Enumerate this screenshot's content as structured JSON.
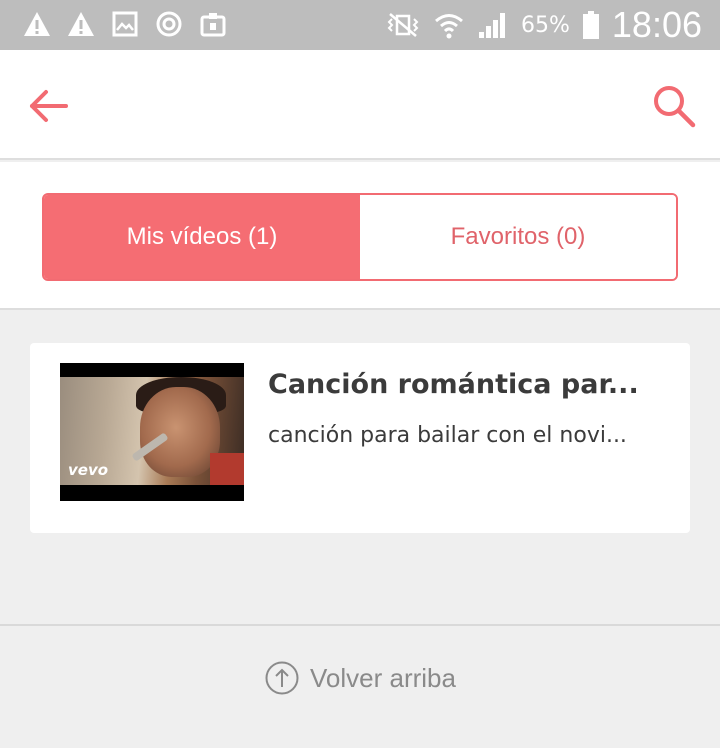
{
  "status_bar": {
    "left_icons": [
      "warning-icon",
      "warning-icon",
      "gallery-icon",
      "sync-icon",
      "clipboard-icon"
    ],
    "right_icons": [
      "vibrate-icon",
      "wifi-icon",
      "signal-icon",
      "battery-icon"
    ],
    "battery_percent": "65%",
    "time": "18:06"
  },
  "app_bar": {
    "back_icon": "arrow-left-icon",
    "search_icon": "search-icon",
    "accent_color": "#f26b72"
  },
  "tabs": {
    "mis_videos": "Mis vídeos (1)",
    "favoritos": "Favoritos (0)"
  },
  "videos": [
    {
      "title": "Canción romántica par...",
      "subtitle": "canción para bailar con el novi...",
      "thumbnail_watermark": "vevo"
    }
  ],
  "footer": {
    "back_to_top": "Volver arriba",
    "icon": "arrow-up-circle-icon"
  }
}
